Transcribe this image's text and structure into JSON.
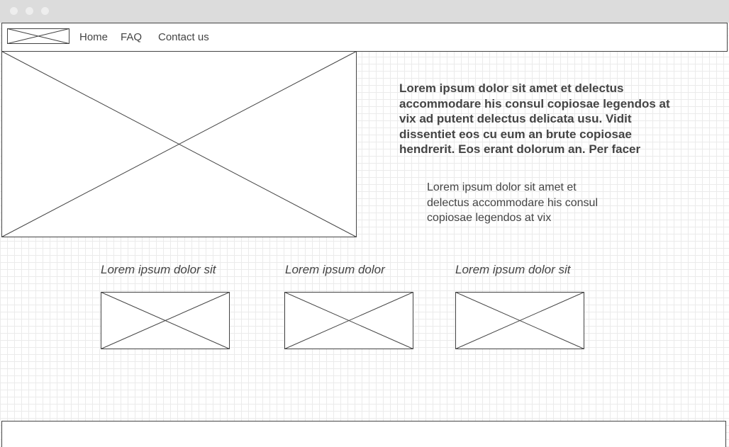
{
  "window": {
    "title_dots": [
      "close-dot",
      "minimize-dot",
      "maximize-dot"
    ]
  },
  "nav": {
    "items": [
      {
        "label": "Home"
      },
      {
        "label": "FAQ"
      },
      {
        "label": "Contact us"
      }
    ]
  },
  "hero": {
    "headline": "Lorem ipsum dolor sit amet et delectus accommodare his consul copiosae legendos at vix ad putent delectus delicata usu. Vidit dissentiet eos cu eum an brute copiosae hendrerit. Eos erant dolorum an. Per facer",
    "body": "Lorem ipsum dolor sit amet et delectus accommodare his consul copiosae legendos at vix"
  },
  "cards": [
    {
      "caption": "Lorem ipsum dolor sit"
    },
    {
      "caption": "Lorem ipsum dolor"
    },
    {
      "caption": "Lorem ipsum dolor sit"
    }
  ],
  "colors": {
    "stroke": "#444444",
    "titlebar": "#dcdcdc",
    "grid": "#ebebeb"
  }
}
